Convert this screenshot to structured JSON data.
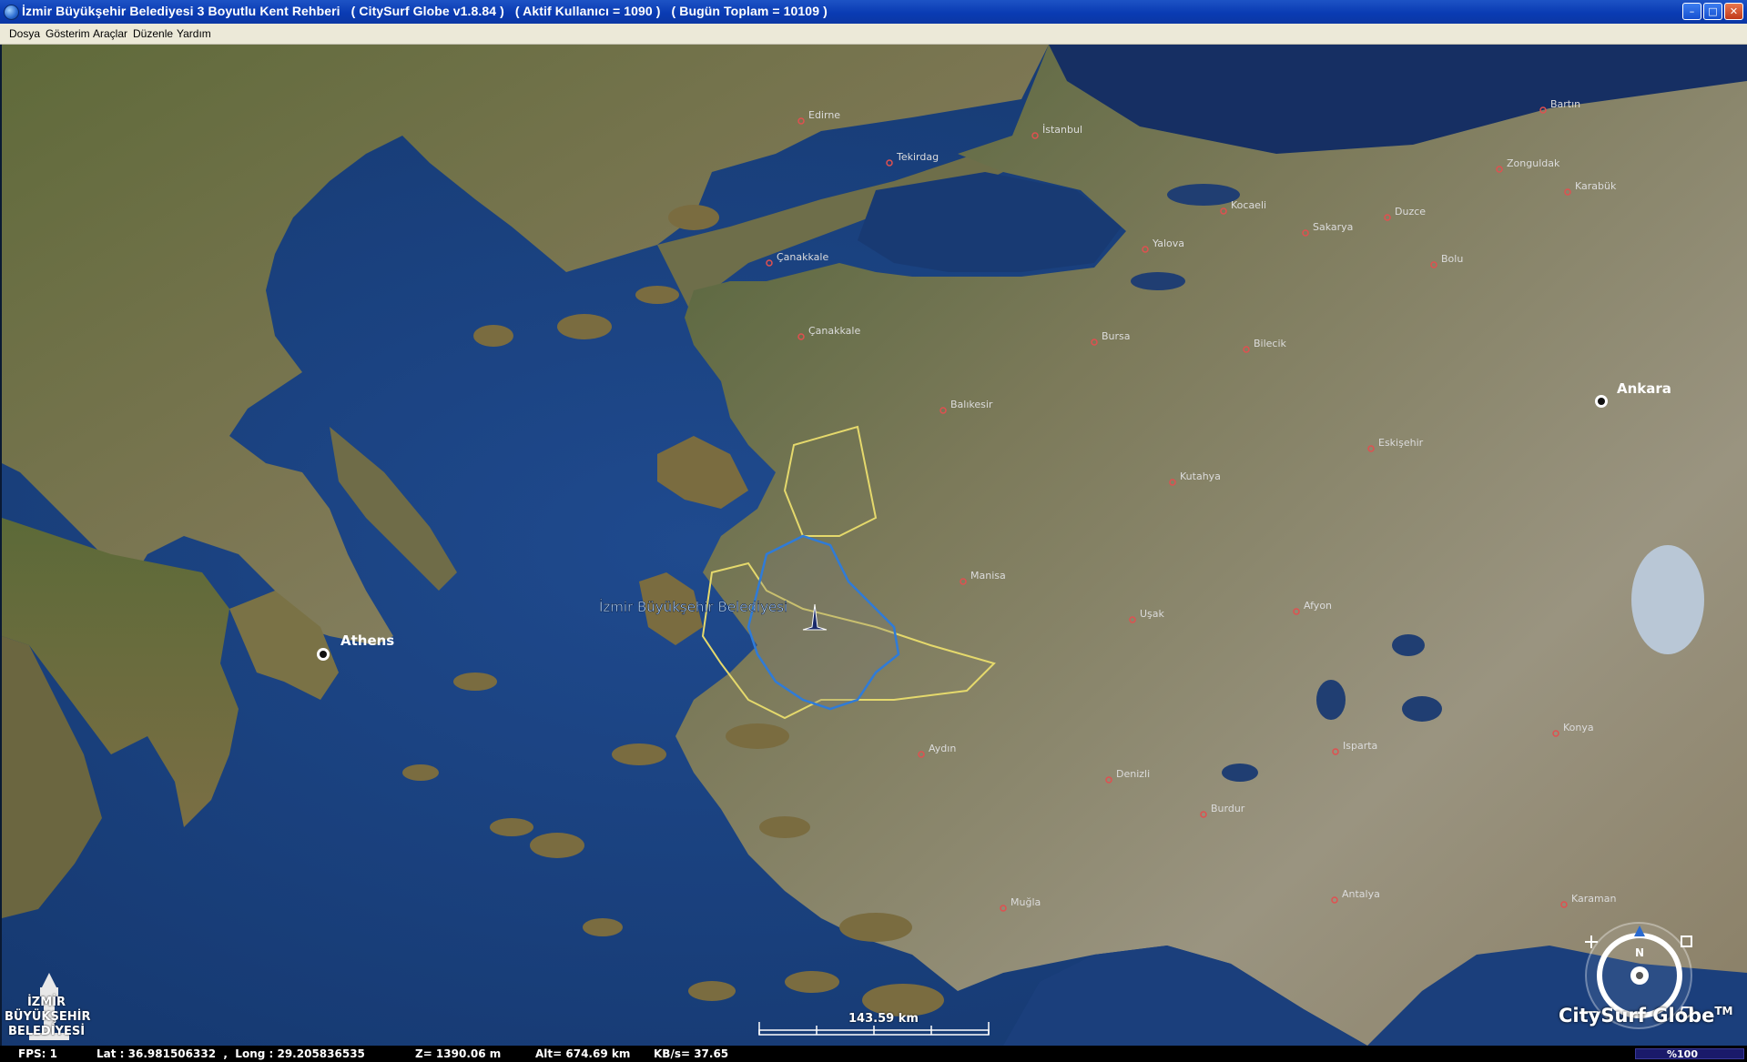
{
  "window": {
    "title": "İzmir Büyükşehir Belediyesi 3 Boyutlu Kent Rehberi   ( CitySurf Globe v1.8.84 )   ( Aktif Kullanıcı = 1090 )   ( Bugün Toplam = 10109 )",
    "minimize_glyph": "–",
    "maximize_glyph": "□",
    "close_glyph": "✕"
  },
  "menu": {
    "items": [
      "Dosya",
      "Gösterim",
      "Araçlar",
      "Düzenle",
      "Yardım"
    ]
  },
  "map": {
    "focus_label": "İzmir Büyükşehir Belediyesi",
    "major_cities": [
      "Athens",
      "Ankara"
    ],
    "cities": [
      "Edirne",
      "İstanbul",
      "Tekirdag",
      "Çanakkale",
      "Çanakkale",
      "Kocaeli",
      "Yalova",
      "Sakarya",
      "Duzce",
      "Bolu",
      "Zonguldak",
      "Karabük",
      "Bursa",
      "Bilecik",
      "Balıkesir",
      "Eskişehir",
      "Kutahya",
      "Manisa",
      "Uşak",
      "Afyon",
      "Aydın",
      "Denizli",
      "Isparta",
      "Burdur",
      "Muğla",
      "Antalya",
      "Konya",
      "Karaman",
      "Bartın"
    ],
    "scale_label": "143.59 km",
    "compass_north_label": "N",
    "brand": "CitySurf Globe",
    "brand_tm": "TM",
    "logo_lines": [
      "İZMİR",
      "BÜYÜKŞEHİR",
      "BELEDİYESİ"
    ],
    "colors": {
      "sea": "#1a3f7e",
      "province_border_inner": "#2f7bd8",
      "province_border_outer": "#e5d96c",
      "city_dot": "#e05050"
    }
  },
  "status": {
    "fps": "FPS: 1",
    "coords": "Lat : 36.981506332  ,  Long : 29.205836535",
    "z": "Z= 1390.06 m",
    "alt": "Alt= 674.69 km",
    "kbs": "KB/s= 37.65",
    "zoom": "%100"
  }
}
